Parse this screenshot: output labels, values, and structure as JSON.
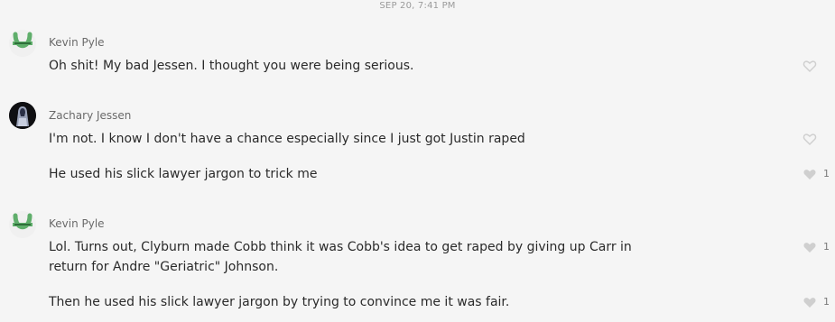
{
  "timestamp": "SEP 20, 7:41 PM",
  "groups": [
    {
      "sender": "Kevin Pyle",
      "avatar_icon": "horseshoe-icon",
      "messages": [
        {
          "text": "Oh shit! My bad Jessen. I thought you were being serious.",
          "liked": false,
          "like_count": ""
        }
      ]
    },
    {
      "sender": "Zachary Jessen",
      "avatar_icon": "hooded-figure-icon",
      "messages": [
        {
          "text": "I'm not. I know I don't have a chance especially since I just got Justin raped",
          "liked": false,
          "like_count": ""
        },
        {
          "text": "He used his slick lawyer jargon to trick me",
          "liked": true,
          "like_count": "1"
        }
      ]
    },
    {
      "sender": "Kevin Pyle",
      "avatar_icon": "horseshoe-icon",
      "messages": [
        {
          "text": "Lol. Turns out, Clyburn made Cobb think it was Cobb's idea to get raped by giving up Carr in return for Andre \"Geriatric\" Johnson.",
          "liked": true,
          "like_count": "1"
        },
        {
          "text": "Then he used his slick lawyer jargon by trying to convince me it was fair.",
          "liked": true,
          "like_count": "1"
        }
      ]
    }
  ],
  "colors": {
    "background": "#f5f5f5",
    "horseshoe_green": "#5fae6b",
    "heart_outline": "#cfcfcf",
    "heart_filled": "#cfcfcf"
  }
}
